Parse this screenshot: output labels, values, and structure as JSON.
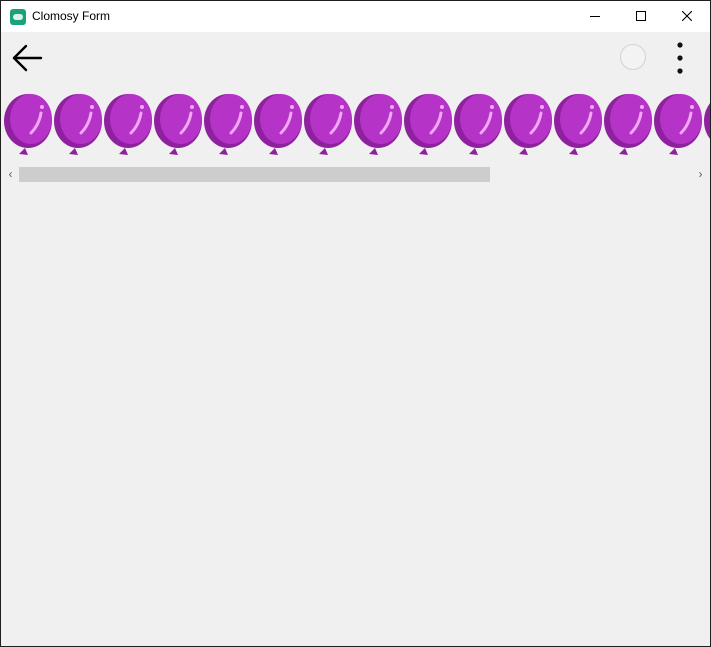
{
  "window": {
    "title": "Clomosy Form",
    "app_icon": "clomosy-app-icon",
    "controls": [
      "minimize-icon",
      "maximize-icon",
      "close-icon"
    ]
  },
  "toolbar": {
    "back_icon": "arrow-left-icon",
    "status_icon": "circle-outline-icon",
    "menu_icon": "more-vertical-icon"
  },
  "balloons": {
    "icon": "balloon-icon",
    "count_visible": 15,
    "color": "#b534c7"
  },
  "scrollbar": {
    "left_arrow": "‹",
    "right_arrow": "›",
    "position_fraction": 0.0,
    "visible_fraction": 0.7
  },
  "colors": {
    "background": "#f0f0f0",
    "titlebar": "#ffffff",
    "balloon": "#b534c7",
    "balloon_dark": "#8f219f",
    "balloon_highlight": "#f2a8f7",
    "scroll_thumb": "#cdcdcd"
  }
}
